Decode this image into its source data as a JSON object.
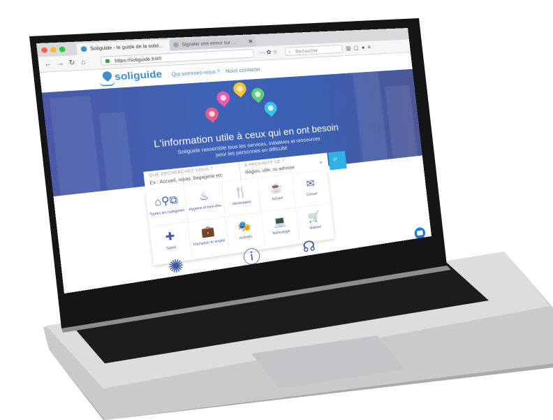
{
  "browser": {
    "tabs": [
      {
        "label": "Soliguide - le guide de la solid..."
      },
      {
        "label": "Signaler une erreur sur ..."
      }
    ],
    "new_tab": "+",
    "url": "https://soliguide.fr/#!/",
    "search_placeholder": "Rechercher",
    "page_actions": "··· ✿ ☆"
  },
  "site": {
    "logo": "soliguide",
    "nav": [
      "Qui sommes-nous ?",
      "Nous contacter"
    ],
    "hero_title": "L'information utile à ceux qui en ont besoin",
    "hero_subtitle": "Soliguide rassemble tous les services, initiatives et ressources pour les personnes en difficulté",
    "search": {
      "what_label": "QUE RECHERCHEZ-VOUS ?",
      "what_placeholder": "Ex : Accueil, repas, bagagerie etc",
      "where_label": "À PROXIMITÉ DE ?",
      "where_placeholder": "Région, ville, ou adresse"
    },
    "categories": [
      {
        "label": "Toutes les catégories",
        "icon": "all-categories-icon"
      },
      {
        "label": "Hygiène et bien-être",
        "icon": "shower-icon"
      },
      {
        "label": "Alimentation",
        "icon": "fork-knife-icon"
      },
      {
        "label": "Accueil",
        "icon": "coffee-cup-icon"
      },
      {
        "label": "Conseil",
        "icon": "envelope-icon"
      },
      {
        "label": "Santé",
        "icon": "first-aid-icon"
      },
      {
        "label": "Formation et emploi",
        "icon": "briefcase-icon"
      },
      {
        "label": "Activités",
        "icon": "theatre-masks-icon"
      },
      {
        "label": "Technologie",
        "icon": "laptop-icon"
      },
      {
        "label": "Matériel",
        "icon": "cart-icon"
      }
    ]
  },
  "colors": {
    "brand": "#3e8ed0",
    "hero": "#3d63b7",
    "search_button": "#2fb0e6",
    "category_icon": "#3e5aa0"
  }
}
